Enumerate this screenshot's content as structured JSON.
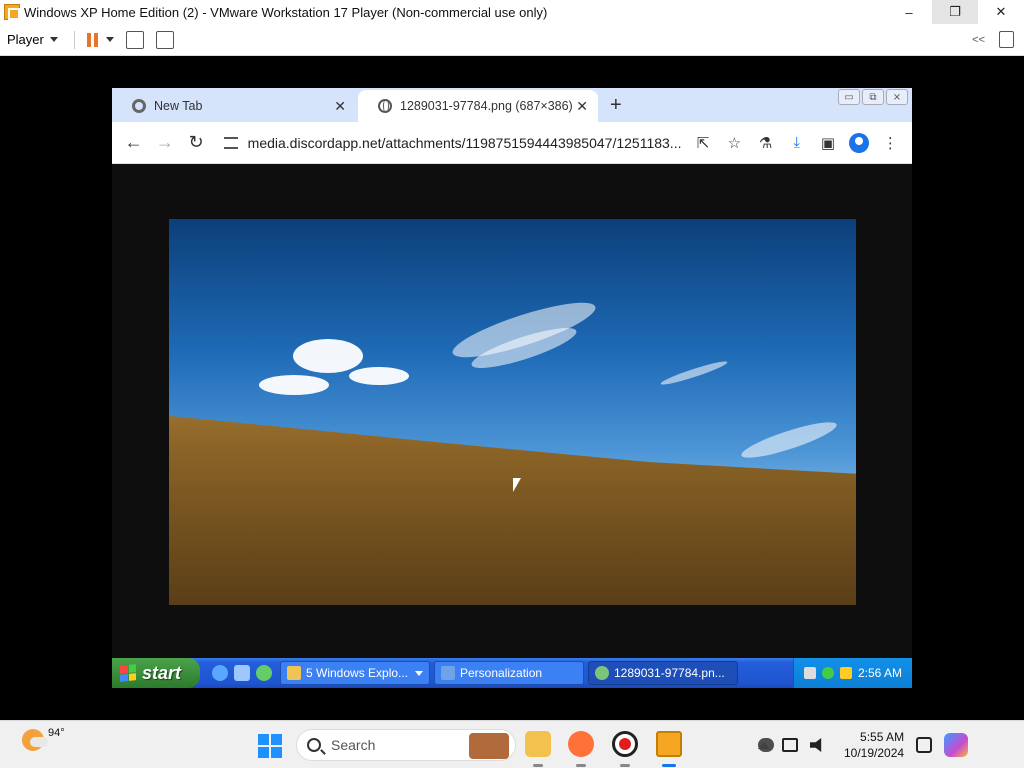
{
  "vmware": {
    "title": "Windows XP Home Edition (2) - VMware Workstation 17 Player (Non-commercial use only)",
    "window_controls": {
      "minimize": "–",
      "maximize": "❐",
      "close": "✕"
    },
    "toolbar": {
      "player_menu": "Player",
      "collapse": "<<"
    }
  },
  "chrome": {
    "tabs": [
      {
        "label": "New Tab",
        "icon": "chrome-logo-icon",
        "active": false
      },
      {
        "label": "1289031-97784.png (687×386)",
        "icon": "globe-icon",
        "active": true
      }
    ],
    "new_tab_symbol": "+",
    "url": "media.discordapp.net/attachments/1198751594443985047/1251183...",
    "xp_controls": {
      "minimize": "▭",
      "restore": "⧉",
      "close": "⨯"
    }
  },
  "xp_taskbar": {
    "start_label": "start",
    "tasks": [
      {
        "label": "5 Windows Explo...",
        "icon": "folder-icon"
      },
      {
        "label": "Personalization",
        "icon": "personalization-icon"
      },
      {
        "label": "1289031-97784.pn...",
        "icon": "chrome-icon"
      }
    ],
    "clock": "2:56 AM"
  },
  "host_taskbar": {
    "weather_temp": "94°",
    "search_placeholder": "Search",
    "time": "5:55 AM",
    "date": "10/19/2024"
  },
  "colors": {
    "xp_blue": "#245edb",
    "xp_start_green": "#3c8f3c",
    "chrome_accent": "#1a73e8",
    "vmware_orange": "#f5a623"
  }
}
